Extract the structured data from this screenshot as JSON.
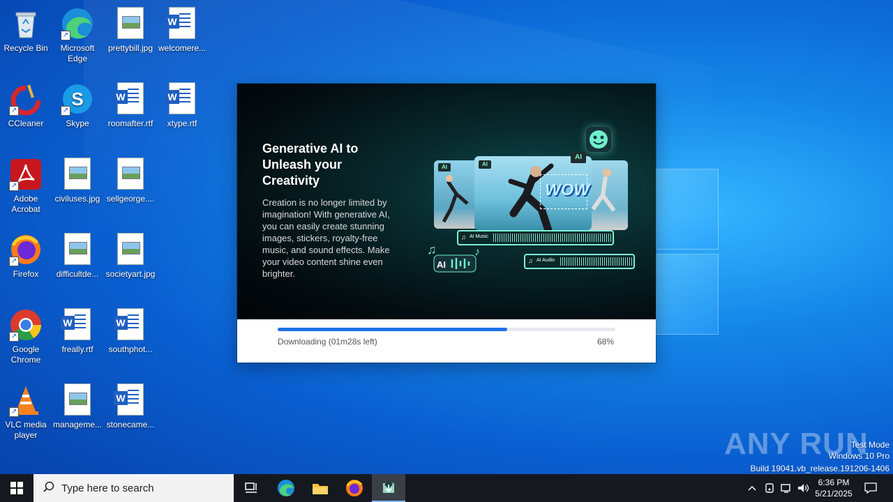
{
  "desktop": {
    "icons": [
      {
        "label": "Recycle Bin"
      },
      {
        "label": "Microsoft Edge"
      },
      {
        "label": "prettybill.jpg"
      },
      {
        "label": "welcomere..."
      },
      {
        "label": "CCleaner"
      },
      {
        "label": "Skype"
      },
      {
        "label": "roomafter.rtf"
      },
      {
        "label": "xtype.rtf"
      },
      {
        "label": "Adobe Acrobat"
      },
      {
        "label": "civiluses.jpg"
      },
      {
        "label": "sellgeorge...."
      },
      {
        "label": "Firefox"
      },
      {
        "label": "difficultde..."
      },
      {
        "label": "societyart.jpg"
      },
      {
        "label": "Google Chrome"
      },
      {
        "label": "freally.rtf"
      },
      {
        "label": "southphot..."
      },
      {
        "label": "VLC media player"
      },
      {
        "label": "manageme..."
      },
      {
        "label": "stonecame..."
      }
    ]
  },
  "installer": {
    "headline": "Generative AI to Unleash your Creativity",
    "description": "Creation is no longer limited by imagination! With generative AI, you can easily create stunning images, stickers, royalty-free music, and sound effects. Make your video content shine even brighter.",
    "promo": {
      "ai_badge": "AI",
      "sticker_text": "WOW",
      "music_track_label": "AI Music",
      "audio_track_label": "AI Audio"
    },
    "progress": {
      "status": "Downloading (01m28s left)",
      "percent_label": "68%",
      "fraction": 0.68
    }
  },
  "watermark": {
    "brand": "ANY RUN",
    "mode": "Test Mode",
    "edition": "Windows 10 Pro",
    "build": "Build 19041.vb_release.191206-1406"
  },
  "taskbar": {
    "search_placeholder": "Type here to search",
    "time": "6:36 PM",
    "date": "5/21/2025"
  },
  "colors": {
    "accent": "#1d6fe8",
    "teal": "#7ff0d6",
    "taskbar": "#15191f"
  }
}
